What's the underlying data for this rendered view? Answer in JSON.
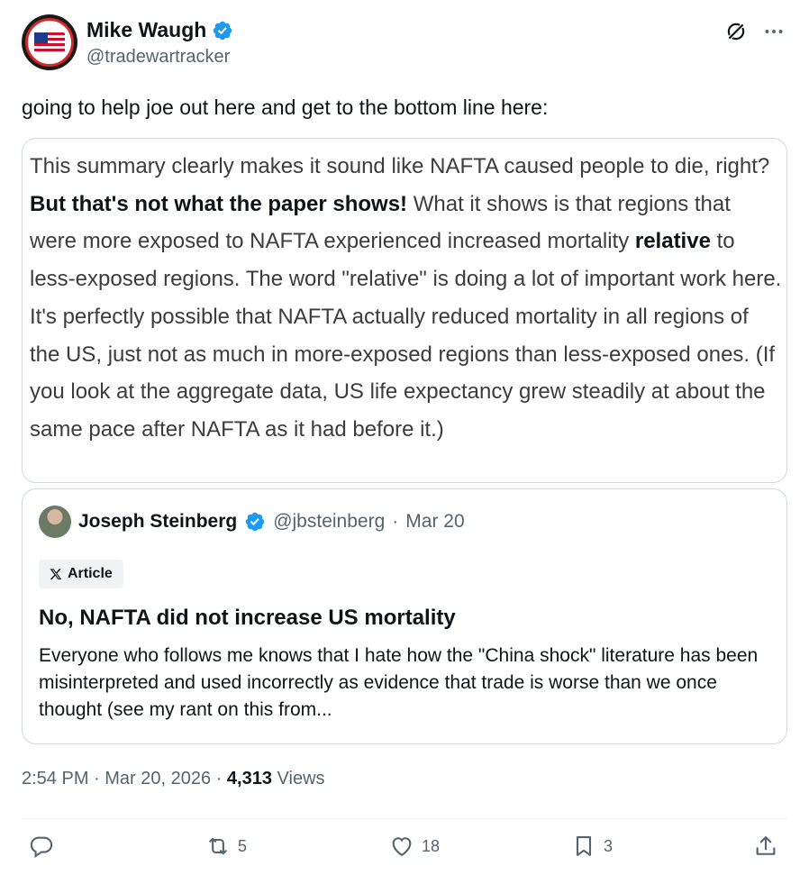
{
  "author": {
    "display_name": "Mike Waugh",
    "handle": "@tradewartracker",
    "verified": true,
    "avatar_icon": "trade-war-tracker-logo"
  },
  "tweet_text": "going to help joe out here and get to the bottom line here:",
  "quoted_excerpt": {
    "part1": "This summary clearly makes it sound like NAFTA caused people to die, right? ",
    "bold1": "But that's not what the paper shows!",
    "part2": " What it shows is that regions that were more exposed to NAFTA experienced increased mortality ",
    "bold2": "relative",
    "part3": " to less-exposed regions. The word \"relative\" is doing a lot of important work here. It's perfectly possible that NAFTA actually reduced mortality in all regions of the US, just not as much in more-exposed regions than less-exposed ones. (If you look at the aggregate data, US life expectancy grew steadily at about the same pace after NAFTA as it had before it.)"
  },
  "embed": {
    "author_name": "Joseph Steinberg",
    "author_handle": "@jbsteinberg",
    "date": "Mar 20",
    "badge_label": "Article",
    "title": "No, NAFTA did not increase US mortality",
    "body": "Everyone who follows me knows that I hate how the \"China shock\" literature has been misinterpreted and used incorrectly as evidence that trade is worse than we once thought (see my rant on this from..."
  },
  "meta": {
    "time": "2:54 PM",
    "date": "Mar 20, 2026",
    "views_count": "4,313",
    "views_label": "Views"
  },
  "actions": {
    "replies": "",
    "retweets": "5",
    "likes": "18",
    "bookmarks": "3"
  },
  "colors": {
    "accent": "#1d9bf0",
    "secondary_text": "#536471",
    "border": "#cfd9de"
  }
}
